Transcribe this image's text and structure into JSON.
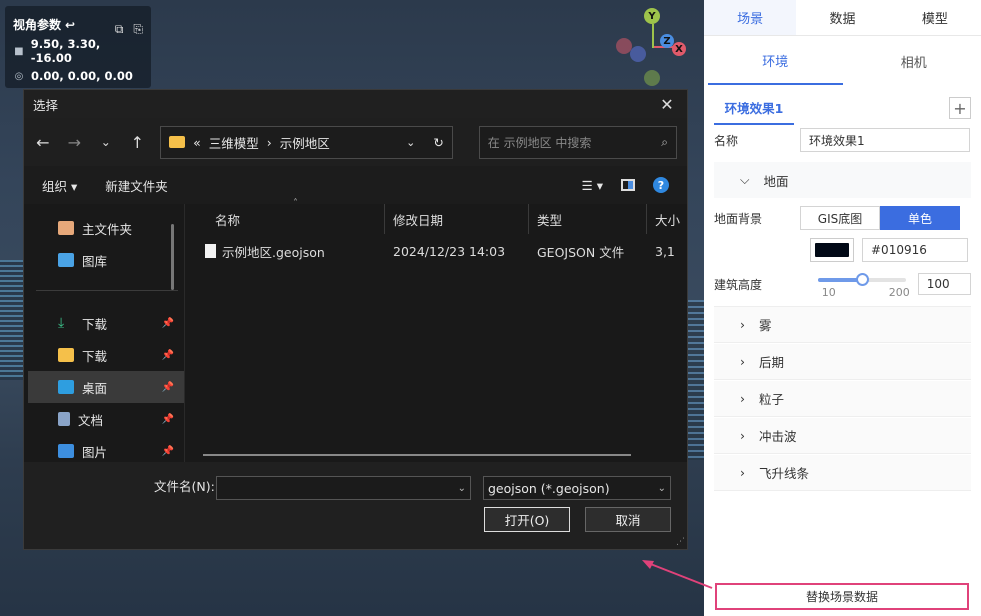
{
  "camera": {
    "title": "视角参数",
    "position": "9.50, 3.30, -16.00",
    "rotation": "0.00, 0.00, 0.00"
  },
  "gizmo": {
    "y": "Y",
    "z": "Z",
    "x": "X"
  },
  "panel": {
    "tabs": [
      "场景",
      "数据",
      "模型"
    ],
    "subtabs": [
      "环境",
      "相机"
    ],
    "effect_tag": "环境效果1",
    "name_label": "名称",
    "name_value": "环境效果1",
    "ground_section": "地面",
    "ground_bg_label": "地面背景",
    "seg_gis": "GIS底图",
    "seg_solid": "单色",
    "color_value": "#010916",
    "height_label": "建筑高度",
    "slider_min": "10",
    "slider_max": "200",
    "height_value": "100",
    "sections": [
      "雾",
      "后期",
      "粒子",
      "冲击波",
      "飞升线条"
    ],
    "replace_button": "替换场景数据"
  },
  "dialog": {
    "title": "选择",
    "path_prefix": "«",
    "path1": "三维模型",
    "path2": "示例地区",
    "search_placeholder": "在 示例地区 中搜索",
    "organize": "组织 ▾",
    "new_folder": "新建文件夹",
    "sidebar": [
      {
        "label": "主文件夹",
        "pin": false
      },
      {
        "label": "图库",
        "pin": false
      },
      {
        "label": "下载",
        "pin": true
      },
      {
        "label": "下载",
        "pin": true
      },
      {
        "label": "桌面",
        "pin": true
      },
      {
        "label": "文档",
        "pin": true
      },
      {
        "label": "图片",
        "pin": true
      }
    ],
    "columns": [
      "名称",
      "修改日期",
      "类型",
      "大小"
    ],
    "files": [
      {
        "name": "示例地区.geojson",
        "date": "2024/12/23 14:03",
        "type": "GEOJSON 文件",
        "size": "3,1"
      }
    ],
    "filename_label": "文件名(N):",
    "filename_value": "",
    "filter": "geojson (*.geojson)",
    "open": "打开(O)",
    "cancel": "取消"
  },
  "colors": {
    "accent": "#3b6de0",
    "highlight": "#e0427a",
    "dialog_bg": "#1f1f1f"
  }
}
